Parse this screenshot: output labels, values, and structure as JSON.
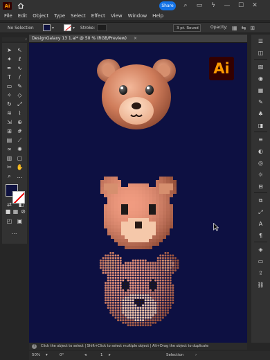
{
  "app": {
    "badge": "Ai",
    "share_label": "Share"
  },
  "menu": [
    "File",
    "Edit",
    "Object",
    "Type",
    "Select",
    "Effect",
    "View",
    "Window",
    "Help"
  ],
  "control": {
    "selection_label": "No Selection",
    "stroke_label": "Stroke:",
    "stroke_style": "3 pt. Round",
    "opacity_label": "Opacity:"
  },
  "document": {
    "tab_title": "DesignGalaxy 13 1.ai* @ 50 % (RGB/Preview)",
    "close": "×"
  },
  "canvas_logo": "Ai",
  "hint": {
    "icon": "?",
    "text": "Click the object to select  |  Shift+Click to select multiple object  |  Alt+Drag the object to duplicate"
  },
  "status": {
    "zoom": "50%",
    "rotation": "0°",
    "artboard": "1",
    "mode": "Selection"
  },
  "colors": {
    "canvas": "#0d1042",
    "accent": "#1473e6",
    "ai_orange": "#ff9a00",
    "ai_dark": "#330000"
  },
  "bears": [
    {
      "name": "smooth-3d-bear",
      "style": "smooth"
    },
    {
      "name": "pixelated-bear",
      "style": "pixel"
    },
    {
      "name": "halftone-dot-bear",
      "style": "dots"
    }
  ]
}
